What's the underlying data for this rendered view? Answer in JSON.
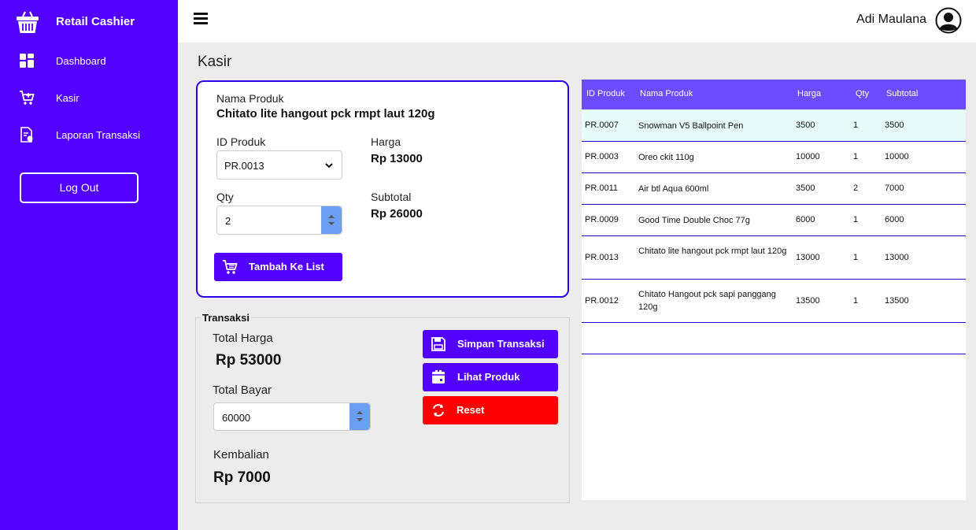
{
  "sidebar": {
    "brand": "Retail Cashier",
    "items": [
      {
        "label": "Dashboard",
        "icon": "dashboard-icon"
      },
      {
        "label": "Kasir",
        "icon": "cart-icon"
      },
      {
        "label": "Laporan Transaksi",
        "icon": "report-icon"
      }
    ],
    "logout": "Log Out"
  },
  "header": {
    "username": "Adi Maulana"
  },
  "page_title": "Kasir",
  "product": {
    "name_label": "Nama Produk",
    "name_value": "Chitato lite hangout pck rmpt laut 120g",
    "id_label": "ID Produk",
    "id_value": "PR.0013",
    "price_label": "Harga",
    "price_value": "Rp  13000",
    "qty_label": "Qty",
    "qty_value": "2",
    "subtotal_label": "Subtotal",
    "subtotal_value": "Rp  26000",
    "add_button": "Tambah Ke List"
  },
  "transaction": {
    "legend": "Transaksi",
    "total_label": "Total Harga",
    "total_value": "Rp  53000",
    "paid_label": "Total Bayar",
    "paid_value": "60000",
    "change_label": "Kembalian",
    "change_value": "Rp  7000",
    "save_button": "Simpan Transaksi",
    "view_button": "Lihat Produk",
    "reset_button": "Reset"
  },
  "table": {
    "headers": [
      "ID Produk",
      "Nama Produk",
      "Harga",
      "Qty",
      "Subtotal"
    ],
    "rows": [
      [
        "PR.0007",
        "Snowman V5 Ballpoint Pen",
        "3500",
        "1",
        "3500"
      ],
      [
        "PR.0003",
        "Oreo ckit 110g",
        "10000",
        "1",
        "10000"
      ],
      [
        "PR.0011",
        "Air btl Aqua 600ml",
        "3500",
        "2",
        "7000"
      ],
      [
        "PR.0009",
        "Good Time Double Choc 77g",
        "6000",
        "1",
        "6000"
      ],
      [
        "PR.0013",
        "Chitato lite hangout pck rmpt laut 120g",
        "13000",
        "1",
        "13000"
      ],
      [
        "PR.0012",
        "Chitato Hangout pck sapi panggang 120g",
        "13500",
        "1",
        "13500"
      ]
    ]
  },
  "colors": {
    "sidebar": "#5200ff",
    "table_header": "#6b4dff",
    "danger": "#ff0000",
    "card_border": "#2a00e8"
  }
}
